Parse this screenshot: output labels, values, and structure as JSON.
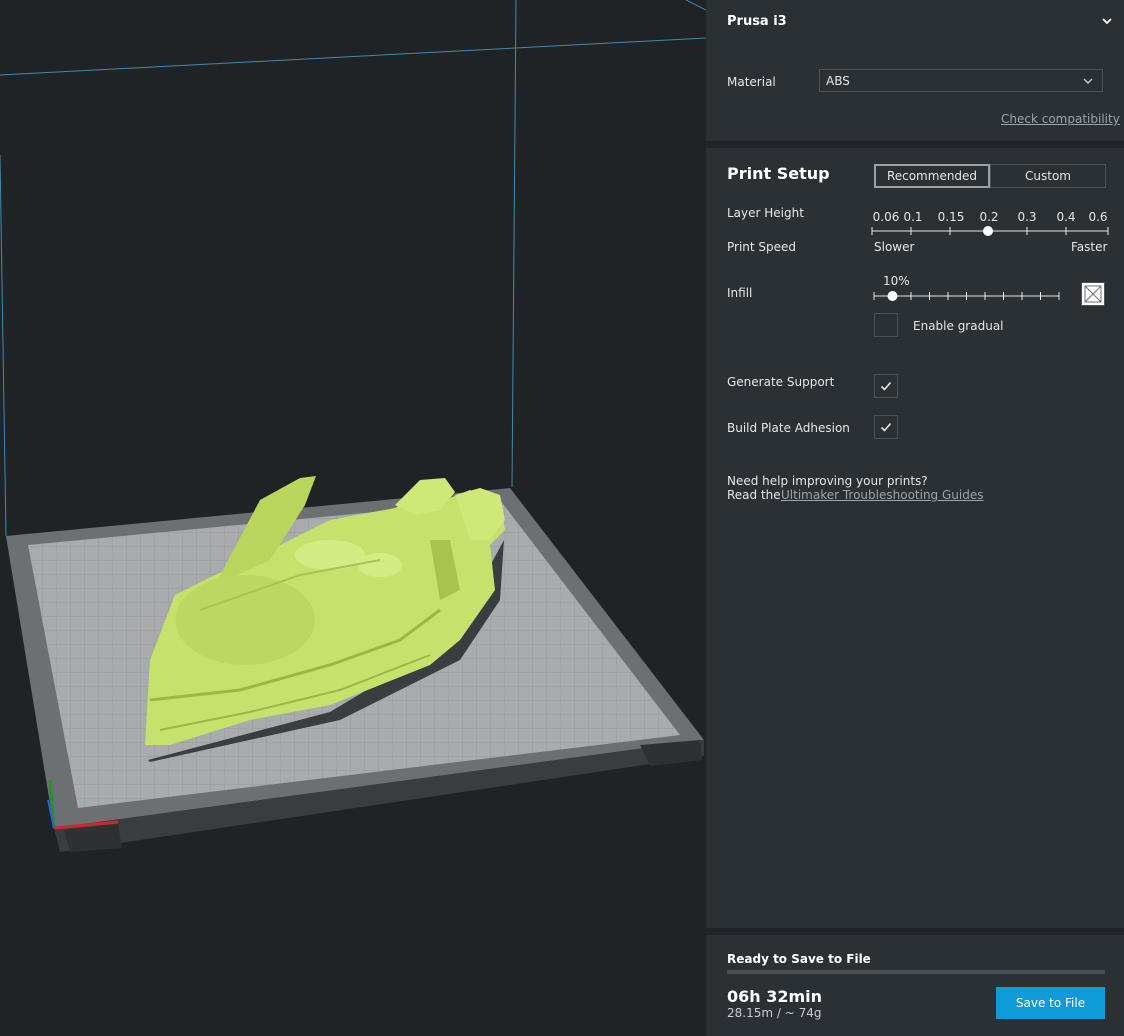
{
  "printer": {
    "name": "Prusa i3",
    "expand_icon": "chevron-down-icon"
  },
  "material": {
    "label": "Material",
    "value": "ABS",
    "dropdown_icon": "chevron-down-icon"
  },
  "compatibility_link": "Check compatibility",
  "print_setup": {
    "title": "Print Setup",
    "modes": [
      "Recommended",
      "Custom"
    ],
    "selected_mode": "Recommended",
    "layer_height": {
      "label": "Layer Height",
      "ticks": [
        "0.06",
        "0.1",
        "0.15",
        "0.2",
        "0.3",
        "0.4",
        "0.6"
      ],
      "selected": "0.2"
    },
    "print_speed": {
      "label": "Print Speed",
      "min_label": "Slower",
      "max_label": "Faster"
    },
    "infill": {
      "label": "Infill",
      "value_label": "10%",
      "value_percent": 10,
      "pattern_icon": "infill-pattern-icon",
      "gradual": {
        "label": "Enable gradual",
        "checked": false
      }
    },
    "generate_support": {
      "label": "Generate Support",
      "checked": true
    },
    "build_plate_adhesion": {
      "label": "Build Plate Adhesion",
      "checked": true
    },
    "help": {
      "line1": "Need help improving your prints?",
      "line2_prefix": "Read the",
      "link": "Ultimaker Troubleshooting Guides"
    }
  },
  "job": {
    "status": "Ready to Save to File",
    "progress_percent": 100,
    "time": "06h 32min",
    "material_usage": "28.15m / ~ 74g",
    "save_button": "Save to File"
  },
  "colors": {
    "accent": "#0f9bd7",
    "model": "#c5e26d",
    "panel": "#2b3035",
    "viewport": "#1f2326"
  }
}
